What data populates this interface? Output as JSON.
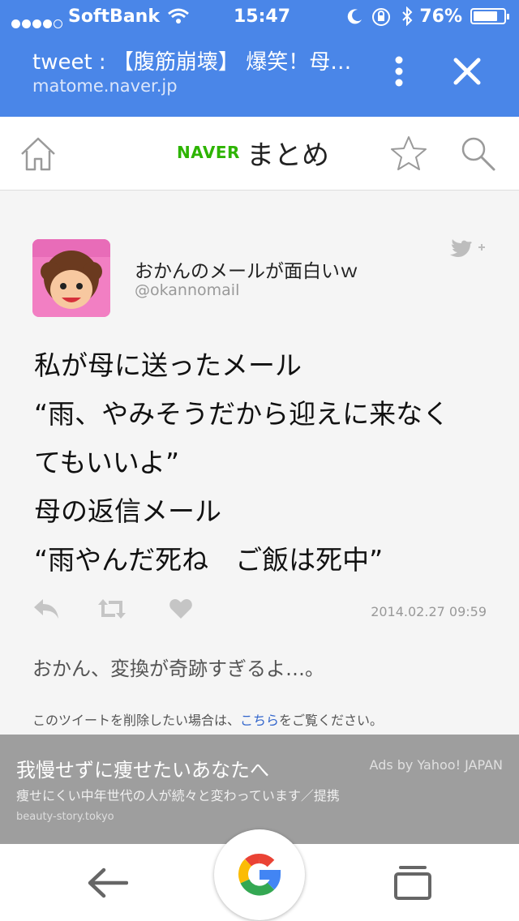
{
  "status_bar": {
    "carrier": "SoftBank",
    "time": "15:47",
    "battery": "76%"
  },
  "browser": {
    "tab_title": "tweet : 【腹筋崩壊】 爆笑！母…",
    "tab_url": "matome.naver.jp",
    "menu_icon": "more-vert-icon",
    "close_icon": "close-icon"
  },
  "site_header": {
    "brand_naver": "NAVER",
    "brand_matome": "まとめ",
    "home_icon": "home-icon",
    "star_icon": "star-icon",
    "search_icon": "search-icon"
  },
  "tweet": {
    "user_name": "おかんのメールが面白いｗ",
    "user_handle": "@okannomail",
    "lines": [
      "私が母に送ったメール",
      "“雨、やみそうだから迎えに来なく",
      "てもいいよ”",
      "母の返信メール",
      "“雨やんだ死ね　ご飯は死中”"
    ],
    "date": "2014.02.27 09:59",
    "comment": "おかん、変換が奇跡すぎるよ…。",
    "delete_note_before": "このツイートを削除したい場合は、",
    "delete_link": "こちら",
    "delete_note_after": "をご覧ください。"
  },
  "ad": {
    "title": "我慢せずに痩せたいあなたへ",
    "label": "Ads by Yahoo! JAPAN",
    "description": "痩せにくい中年世代の人が続々と変わっています／提携",
    "domain": "beauty-story.tokyo"
  },
  "bottom_nav": {
    "back_icon": "arrow-left-icon",
    "google_icon": "google-g-icon",
    "tabs_icon": "tabs-icon"
  },
  "colors": {
    "chrome_blue": "#4a86e8",
    "naver_green": "#2db400",
    "link_blue": "#3366cc"
  }
}
